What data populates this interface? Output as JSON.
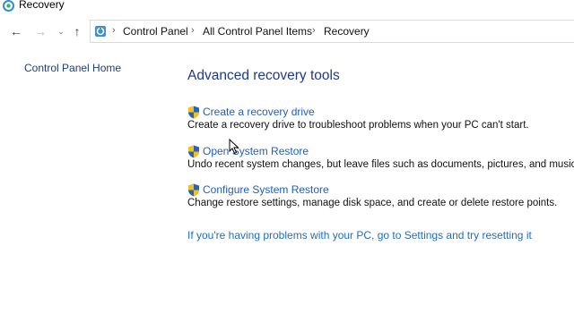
{
  "window": {
    "title": "Recovery"
  },
  "navigation": {
    "breadcrumb": [
      "Control Panel",
      "All Control Panel Items",
      "Recovery"
    ]
  },
  "sidebar": {
    "home_link": "Control Panel Home"
  },
  "main": {
    "heading": "Advanced recovery tools",
    "tasks": [
      {
        "label": "Create a recovery drive",
        "description": "Create a recovery drive to troubleshoot problems when your PC can't start."
      },
      {
        "label": "Open System Restore",
        "description": "Undo recent system changes, but leave files such as documents, pictures, and music un"
      },
      {
        "label": "Configure System Restore",
        "description": "Change restore settings, manage disk space, and create or delete restore points."
      }
    ],
    "reset_link": "If you're having problems with your PC, go to Settings and try resetting it"
  },
  "icons": {
    "task_icon": "uac-shield-icon",
    "window_icon": "recovery-icon"
  },
  "colors": {
    "heading": "#1e3a8c",
    "link": "#1f5fbf",
    "sidebar_link": "#1b3e7a"
  }
}
